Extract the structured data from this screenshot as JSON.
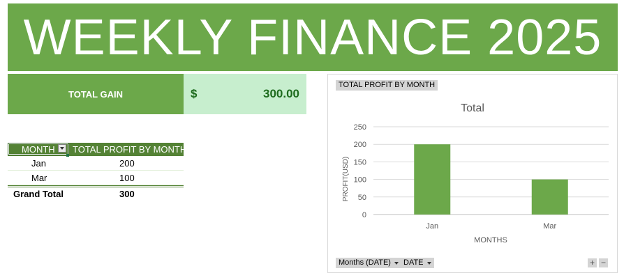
{
  "banner": {
    "title": "WEEKLY FINANCE 2025"
  },
  "summary": {
    "label": "TOTAL GAIN",
    "currency": "$",
    "value": "300.00"
  },
  "pivot": {
    "headers": {
      "month": "MONTH",
      "profit": "TOTAL PROFIT BY MONTH"
    },
    "rows": [
      {
        "month": "Jan",
        "profit": "200"
      },
      {
        "month": "Mar",
        "profit": "100"
      }
    ],
    "total": {
      "label": "Grand Total",
      "value": "300"
    }
  },
  "chart_panel": {
    "value_field": "TOTAL PROFIT BY MONTH",
    "axis_fields": [
      "Months (DATE)",
      "DATE"
    ],
    "zoom_in": "+",
    "zoom_out": "−"
  },
  "colors": {
    "brand_green": "#6ca84a",
    "header_green": "#548235",
    "gain_bg": "#c7eece",
    "gain_text": "#1e6b1e",
    "bar": "#6ca84a"
  },
  "chart_data": {
    "type": "bar",
    "title": "Total",
    "xlabel": "MONTHS",
    "ylabel": "PROFIT(USD)",
    "categories": [
      "Jan",
      "Mar"
    ],
    "values": [
      200,
      100
    ],
    "ylim": [
      0,
      250
    ],
    "yticks": [
      "0",
      "50",
      "100",
      "150",
      "200",
      "250"
    ],
    "grid": true
  }
}
